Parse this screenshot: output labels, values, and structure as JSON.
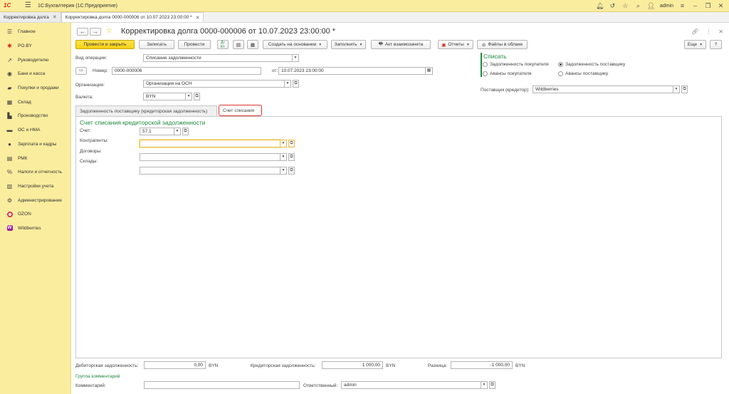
{
  "app": {
    "title": "1С:Бухгалтерия  (1С:Предприятие)",
    "logo": "1С",
    "user": "admin",
    "icons": [
      "bell-icon",
      "history-icon",
      "star-icon",
      "search-icon",
      "settings-icon",
      "minimize-icon",
      "restore-icon",
      "close-icon"
    ]
  },
  "window_tabs": [
    {
      "label": "Корректировка долга"
    },
    {
      "label": "Корректировка долга 0000-000006 от 10.07.2023 23:00:00 *"
    }
  ],
  "sidebar": {
    "items": [
      {
        "label": "Главное",
        "icon": "menu-icon"
      },
      {
        "label": "PO.BY",
        "icon": "po-by-icon"
      },
      {
        "label": "Руководителю",
        "icon": "chart-icon"
      },
      {
        "label": "Банк и касса",
        "icon": "bank-icon"
      },
      {
        "label": "Покупки и продажи",
        "icon": "cart-icon"
      },
      {
        "label": "Склад",
        "icon": "warehouse-icon"
      },
      {
        "label": "Производство",
        "icon": "factory-icon"
      },
      {
        "label": "ОС и НМА",
        "icon": "truck-icon"
      },
      {
        "label": "Зарплата и кадры",
        "icon": "person-icon"
      },
      {
        "label": "РМК",
        "icon": "cash-register-icon"
      },
      {
        "label": "Налоги и отчетность",
        "icon": "percent-icon"
      },
      {
        "label": "Настройки учета",
        "icon": "list-icon"
      },
      {
        "label": "Администрирование",
        "icon": "gear-icon"
      },
      {
        "label": "OZON",
        "icon": "ozon-icon"
      },
      {
        "label": "Wildberries",
        "icon": "wildberries-icon"
      }
    ]
  },
  "document": {
    "title": "Корректировка долга 0000-000006 от 10.07.2023 23:00:00 *"
  },
  "toolbar": {
    "post_close": "Провести и закрыть",
    "save": "Записать",
    "post": "Провести",
    "create_based": "Создать на основании",
    "fill": "Заполнить",
    "offset_act": "Акт взаимозачета",
    "reports": "Отчеты",
    "cloud_files": "Файлы в облаке",
    "more": "Еще"
  },
  "form": {
    "op_type_label": "Вид операции:",
    "op_type_value": "Списание задолженности",
    "number_label": "Номер:",
    "number_value": "0000-000006",
    "date_label": "от:",
    "date_value": "10.07.2023 23:00:00",
    "org_label": "Организация:",
    "org_value": "Организация на ОСН",
    "currency_label": "Валюта:",
    "currency_value": "BYN",
    "writeoff_title": "Списать",
    "radio": {
      "buyer_debt": "Задолженность покупателя",
      "supplier_debt": "Задолженность поставщику",
      "buyer_advances": "Авансы покупателя",
      "supplier_advances": "Авансы поставщику",
      "selected": "supplier_debt"
    },
    "supplier_label": "Поставщик (кредитор):",
    "supplier_value": "Wildberries"
  },
  "form_tabs": {
    "tab1": "Задолженность поставщику (кредиторская задолженность)",
    "tab2": "Счет списания"
  },
  "panel": {
    "title": "Счет списания кредиторской задолженности",
    "account_label": "Счет:",
    "account_value": "57.1",
    "counterparties_label": "Контрагенты:",
    "contracts_label": "Договоры:",
    "warehouses_label": "Склады:"
  },
  "footer": {
    "debit_label": "Дебиторская задолженность:",
    "debit_value": "0,00",
    "credit_label": "Кредиторская задолженность:",
    "credit_value": "1 000,00",
    "diff_label": "Разница:",
    "diff_value": "-1 000,00",
    "currency": "BYN",
    "comment_group": "Группа комментарий",
    "comment_label": "Комментарий:",
    "comment_value": "",
    "responsible_label": "Ответственный:",
    "responsible_value": "admin"
  }
}
